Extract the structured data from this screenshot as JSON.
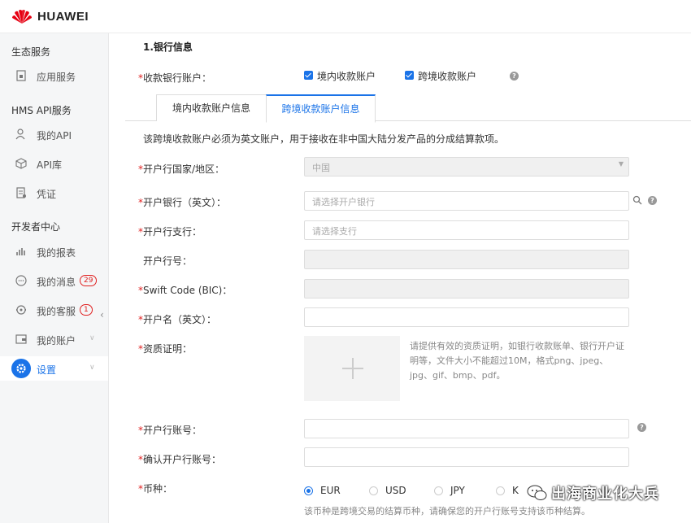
{
  "brand": {
    "name": "HUAWEI",
    "logo_color": "#e60012"
  },
  "accent_color": "#1a73e8",
  "sidebar": {
    "groups": [
      {
        "title": "生态服务",
        "items": [
          {
            "label": "应用服务",
            "icon": "app-store-icon"
          }
        ]
      },
      {
        "title": "HMS API服务",
        "items": [
          {
            "label": "我的API",
            "icon": "user-api-icon"
          },
          {
            "label": "API库",
            "icon": "cube-icon"
          },
          {
            "label": "凭证",
            "icon": "credential-icon"
          }
        ]
      },
      {
        "title": "开发者中心",
        "items": [
          {
            "label": "我的报表",
            "icon": "bar-chart-icon"
          },
          {
            "label": "我的消息",
            "icon": "message-icon",
            "badge": "29"
          },
          {
            "label": "我的客服",
            "icon": "customer-service-icon",
            "badge": "1"
          },
          {
            "label": "我的账户",
            "icon": "wallet-icon"
          },
          {
            "label": "设置",
            "icon": "gear-icon",
            "active": true
          }
        ]
      }
    ]
  },
  "section_title": "1.银行信息",
  "account_type": {
    "label": "收款银行账户：",
    "options": [
      {
        "label": "境内收款账户",
        "checked": true
      },
      {
        "label": "跨境收款账户",
        "checked": true
      }
    ]
  },
  "tabs": [
    {
      "label": "境内收款账户信息",
      "active": false
    },
    {
      "label": "跨境收款账户信息",
      "active": true
    }
  ],
  "notice": "该跨境收款账户必须为英文账户，用于接收在非中国大陆分发产品的分成结算款项。",
  "fields": {
    "country": {
      "label": "开户行国家/地区：",
      "value": "中国"
    },
    "bank": {
      "label": "开户银行（英文）：",
      "placeholder": "请选择开户银行"
    },
    "branch": {
      "label": "开户行支行：",
      "placeholder": "请选择支行"
    },
    "bank_no": {
      "label": "开户行号："
    },
    "swift": {
      "label": "Swift Code (BIC)："
    },
    "holder": {
      "label": "开户名（英文）："
    },
    "cert": {
      "label": "资质证明：",
      "hint": "请提供有效的资质证明，如银行收款账单、银行开户证明等，文件大小不能超过10M，格式png、jpeg、jpg、gif、bmp、pdf。"
    },
    "account_no": {
      "label": "开户行账号："
    },
    "confirm_no": {
      "label": "确认开户行账号："
    },
    "currency": {
      "label": "币种：",
      "options": [
        {
          "label": "EUR",
          "selected": true
        },
        {
          "label": "USD"
        },
        {
          "label": "JPY"
        },
        {
          "label": "K"
        }
      ],
      "hint": "该币种是跨境交易的结算币种，请确保您的开户行账号支持该币种结算。"
    }
  },
  "watermark": "出海商业化大兵"
}
